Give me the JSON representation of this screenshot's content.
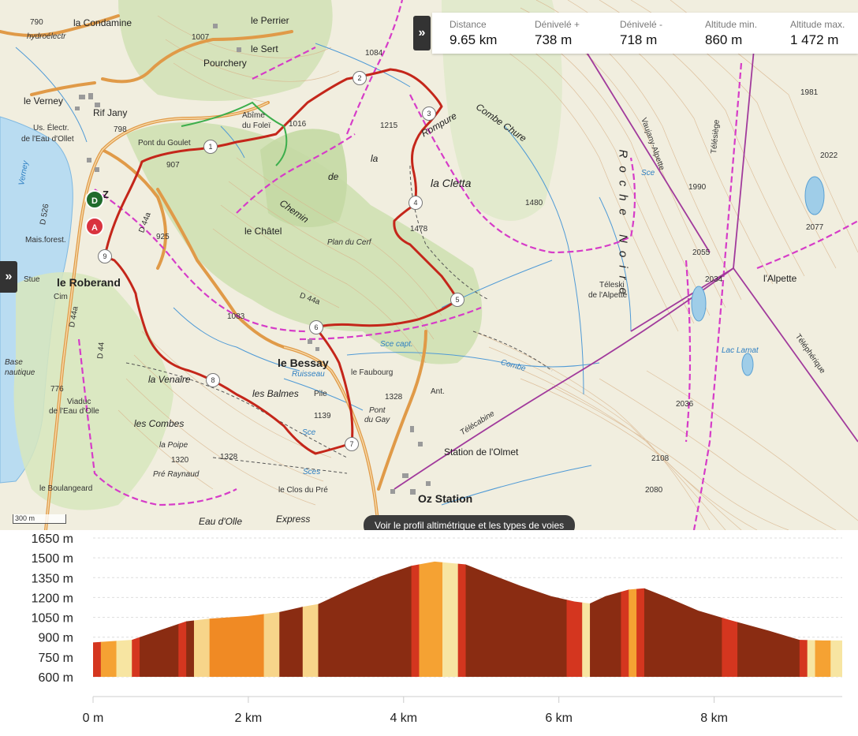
{
  "stats": [
    {
      "label": "Distance",
      "value": "9.65 km"
    },
    {
      "label": "Dénivelé +",
      "value": "738 m"
    },
    {
      "label": "Dénivelé -",
      "value": "718 m"
    },
    {
      "label": "Altitude min.",
      "value": "860 m"
    },
    {
      "label": "Altitude max.",
      "value": "1 472 m"
    }
  ],
  "controls": {
    "expand_stats": "»",
    "expand_left": "»",
    "profile_button": "Voir le profil altimétrique et les types de voies",
    "scale": "300 m"
  },
  "markers": {
    "start": "D",
    "end": "A"
  },
  "waypoints": [
    "1",
    "2",
    "3",
    "4",
    "5",
    "6",
    "7",
    "8",
    "9"
  ],
  "places": {
    "la_condamine": "la Condamine",
    "hydroelectr": "hydroélectr",
    "le_perrier": "le Perrier",
    "le_sert": "le Sert",
    "pourchery": "Pourchery",
    "le_verney": "le Verney",
    "rif_jany": "Rif Jany",
    "us_electr": "Us. Électr.",
    "eau_dollet": "de l'Eau d'Ollet",
    "pont_du_goulet": "Pont du Goulet",
    "abime_du_folei": "Abîme",
    "abime_du_folei_2": "du Foleï",
    "la_rompure": "Rompure",
    "combe_chure": "Combe Chure",
    "la_cletta": "la Cletta",
    "chemin": "Chemin",
    "de": "de",
    "la": "la",
    "le_chatel": "le Châtel",
    "plan_du_cerf": "Plan du Cerf",
    "le_roberand": "le Roberand",
    "le_bessay": "le Bessay",
    "le_faubourg": "le Faubourg",
    "la_venaire": "la Venaire",
    "les_balmes": "les Balmes",
    "les_combes": "les Combes",
    "la_poipe": "la Poipe",
    "pre_raynaud": "Pré Raynaud",
    "le_boulangeard": "le Boulangeard",
    "le_clos_du_pre": "le Clos du Pré",
    "pont_du_gay": "Pont",
    "pont_du_gay_2": "du Gay",
    "station_olmet": "Station de l'Olmet",
    "oz_station": "Oz Station",
    "telecabine": "Télécabine",
    "lalpette": "l'Alpette",
    "teleski": "Téleski",
    "teleski_2": "de l'Alpette",
    "viaduc": "Viaduc",
    "viaduc_2": "de l'Eau d'Olle",
    "eau_dolle": "Eau d'Olle",
    "express": "Express",
    "verney": "Verney",
    "d526": "D 526",
    "d44a": "D 44a",
    "d44": "D 44",
    "roche_noire": "Roche Noire",
    "base": "Base",
    "nautique": "nautique",
    "stue": "Stue",
    "cim": "Cim",
    "ruisseau": "Ruisseau",
    "combe": "Combe",
    "alpette_vaujany": "Vaujany-Alpette",
    "telesiege": "Télésiège",
    "telepherique": "Téléphérique",
    "lac_lamat": "Lac Lamat",
    "pile": "Pile",
    "ant": "Ant.",
    "sce": "Sce",
    "sces": "Sces",
    "sce_capt": "Sce capt.",
    "mais_forest": "Mais.forest.",
    "ozyl": "Z"
  },
  "elevations": [
    "790",
    "1007",
    "1084",
    "1016",
    "1215",
    "1478",
    "1480",
    "1990",
    "1981",
    "2022",
    "2077",
    "2055",
    "2034",
    "2036",
    "2108",
    "2080",
    "925",
    "907",
    "798",
    "1083",
    "1139",
    "1320",
    "1328",
    "1328",
    "776"
  ],
  "chart_data": {
    "type": "area",
    "title": "",
    "xlabel": "",
    "ylabel": "",
    "x_ticks": [
      0,
      2,
      4,
      6,
      8
    ],
    "x_tick_labels": [
      "0 m",
      "2 km",
      "4 km",
      "6 km",
      "8 km"
    ],
    "y_ticks": [
      600,
      750,
      900,
      1050,
      1200,
      1350,
      1500,
      1650
    ],
    "y_tick_labels": [
      "600 m",
      "750 m",
      "900 m",
      "1050 m",
      "1200 m",
      "1350 m",
      "1500 m",
      "1650 m"
    ],
    "xlim": [
      0,
      9.65
    ],
    "ylim": [
      600,
      1650
    ],
    "series": [
      {
        "x": [
          0,
          0.5,
          0.9,
          1.2,
          1.5,
          2.0,
          2.4,
          2.7,
          2.9,
          3.3,
          3.7,
          4.1,
          4.4,
          4.8,
          5.1,
          5.5,
          5.9,
          6.2,
          6.4,
          6.6,
          6.9,
          7.1,
          7.4,
          7.8,
          8.2,
          8.7,
          9.1,
          9.4,
          9.65
        ],
        "y": [
          860,
          880,
          960,
          1020,
          1040,
          1060,
          1090,
          1130,
          1150,
          1260,
          1360,
          1440,
          1472,
          1450,
          1380,
          1290,
          1210,
          1170,
          1155,
          1210,
          1260,
          1270,
          1200,
          1100,
          1030,
          950,
          880,
          875,
          875
        ]
      }
    ],
    "surface_segments": [
      {
        "from": 0,
        "to": 0.1,
        "color": "#d4361f"
      },
      {
        "from": 0.1,
        "to": 0.3,
        "color": "#f5a233"
      },
      {
        "from": 0.3,
        "to": 0.5,
        "color": "#f7e5a2"
      },
      {
        "from": 0.5,
        "to": 0.6,
        "color": "#d4361f"
      },
      {
        "from": 0.6,
        "to": 1.1,
        "color": "#8a2c12"
      },
      {
        "from": 1.1,
        "to": 1.2,
        "color": "#d4361f"
      },
      {
        "from": 1.2,
        "to": 1.3,
        "color": "#8a2c12"
      },
      {
        "from": 1.3,
        "to": 1.5,
        "color": "#f7d58a"
      },
      {
        "from": 1.5,
        "to": 2.2,
        "color": "#f08a24"
      },
      {
        "from": 2.2,
        "to": 2.4,
        "color": "#f7d58a"
      },
      {
        "from": 2.4,
        "to": 2.7,
        "color": "#8a2c12"
      },
      {
        "from": 2.7,
        "to": 2.9,
        "color": "#f7d58a"
      },
      {
        "from": 2.9,
        "to": 4.1,
        "color": "#8a2c12"
      },
      {
        "from": 4.1,
        "to": 4.2,
        "color": "#d4361f"
      },
      {
        "from": 4.2,
        "to": 4.5,
        "color": "#f5a233"
      },
      {
        "from": 4.5,
        "to": 4.7,
        "color": "#f7e5a2"
      },
      {
        "from": 4.7,
        "to": 4.8,
        "color": "#d4361f"
      },
      {
        "from": 4.8,
        "to": 6.1,
        "color": "#8a2c12"
      },
      {
        "from": 6.1,
        "to": 6.3,
        "color": "#d4361f"
      },
      {
        "from": 6.3,
        "to": 6.4,
        "color": "#f7e5a2"
      },
      {
        "from": 6.4,
        "to": 6.8,
        "color": "#8a2c12"
      },
      {
        "from": 6.8,
        "to": 6.9,
        "color": "#d4361f"
      },
      {
        "from": 6.9,
        "to": 7.0,
        "color": "#f5a233"
      },
      {
        "from": 7.0,
        "to": 7.1,
        "color": "#d4361f"
      },
      {
        "from": 7.1,
        "to": 8.1,
        "color": "#8a2c12"
      },
      {
        "from": 8.1,
        "to": 8.3,
        "color": "#d4361f"
      },
      {
        "from": 8.3,
        "to": 9.1,
        "color": "#8a2c12"
      },
      {
        "from": 9.1,
        "to": 9.2,
        "color": "#d4361f"
      },
      {
        "from": 9.2,
        "to": 9.3,
        "color": "#f7e5a2"
      },
      {
        "from": 9.3,
        "to": 9.5,
        "color": "#f5a233"
      },
      {
        "from": 9.5,
        "to": 9.65,
        "color": "#f7e5a2"
      }
    ],
    "grid": true,
    "colors": {
      "grid": "#dddddd",
      "axis": "#cccccc",
      "label": "#222222"
    }
  }
}
